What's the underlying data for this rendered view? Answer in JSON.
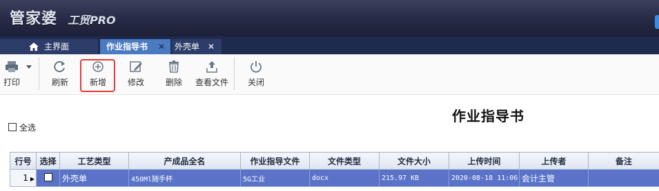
{
  "app": {
    "logo_main": "管家婆",
    "logo_sub": "工贸PRO"
  },
  "tabs": [
    {
      "label": "主界面",
      "icon": "home-icon"
    },
    {
      "label": "作业指导书",
      "close": "✕"
    },
    {
      "label": "外壳单",
      "close": "✕"
    }
  ],
  "toolbar": {
    "print": "打印",
    "refresh": "刷新",
    "add": "新增",
    "edit": "修改",
    "delete": "删除",
    "view_file": "查看文件",
    "close": "关闭"
  },
  "page": {
    "title": "作业指导书",
    "select_all": "全选"
  },
  "grid": {
    "columns": [
      "行号",
      "选择",
      "工艺类型",
      "产成品全名",
      "作业指导文件",
      "文件类型",
      "文件大小",
      "上传时间",
      "上传者",
      "备注"
    ],
    "rows": [
      {
        "row_no": "1",
        "process_type": "外壳单",
        "product_name": "450Ml随手杯",
        "guide_file": "5G工业",
        "file_type": "docx",
        "file_size": "215.97 KB",
        "upload_time": "2020-08-18 11:06",
        "uploader": "会计主管",
        "remark": ""
      }
    ]
  },
  "colors": {
    "header": "#262a45",
    "active_tab": "#4a7bc1",
    "selected_row": "#5a73c8",
    "highlight": "#e53935"
  }
}
